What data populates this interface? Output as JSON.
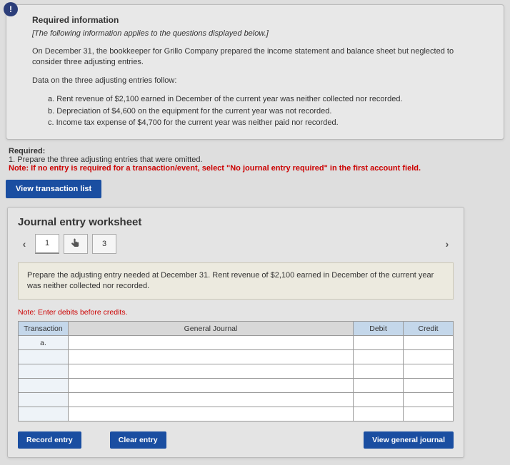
{
  "info": {
    "title": "Required information",
    "subtitle": "[The following information applies to the questions displayed below.]",
    "para1": "On December 31, the bookkeeper for Grillo Company prepared the income statement and balance sheet but neglected to consider three adjusting entries.",
    "para2": "Data on the three adjusting entries follow:",
    "items": {
      "a": "a. Rent revenue of $2,100 earned in December of the current year was neither collected nor recorded.",
      "b": "b. Depreciation of $4,600 on the equipment for the current year was not recorded.",
      "c": "c. Income tax expense of $4,700 for the current year was neither paid nor recorded."
    }
  },
  "required": {
    "heading": "Required:",
    "line1": "1. Prepare the three adjusting entries that were omitted.",
    "note": "Note: If no entry is required for a transaction/event, select \"No journal entry required\" in the first account field."
  },
  "buttons": {
    "view_list": "View transaction list",
    "record": "Record entry",
    "clear": "Clear entry",
    "view_journal": "View general journal"
  },
  "worksheet": {
    "title": "Journal entry worksheet",
    "tabs": {
      "t1": "1",
      "t3": "3"
    },
    "prompt": "Prepare the adjusting entry needed at December 31. Rent revenue of $2,100 earned in December of the current year was neither collected nor recorded.",
    "note": "Note: Enter debits before credits.",
    "headers": {
      "transaction": "Transaction",
      "journal": "General Journal",
      "debit": "Debit",
      "credit": "Credit"
    },
    "txn_label": "a."
  }
}
